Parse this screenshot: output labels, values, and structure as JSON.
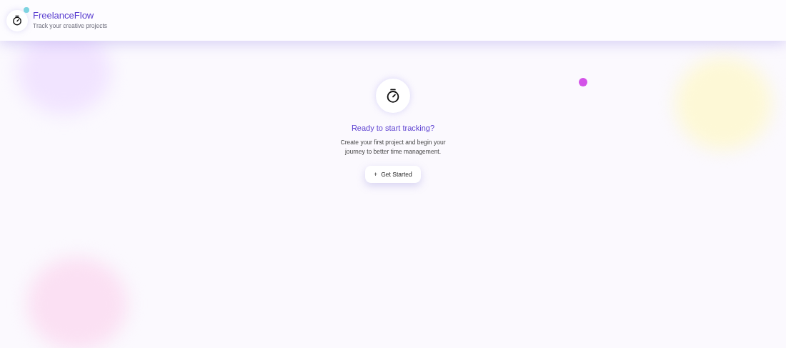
{
  "header": {
    "title": "FreelanceFlow",
    "subtitle": "Track your creative projects"
  },
  "empty_state": {
    "heading": "Ready to start tracking?",
    "message": "Create your first project and begin your journey to better time management.",
    "button": {
      "icon": "+",
      "label": "Get Started"
    }
  }
}
